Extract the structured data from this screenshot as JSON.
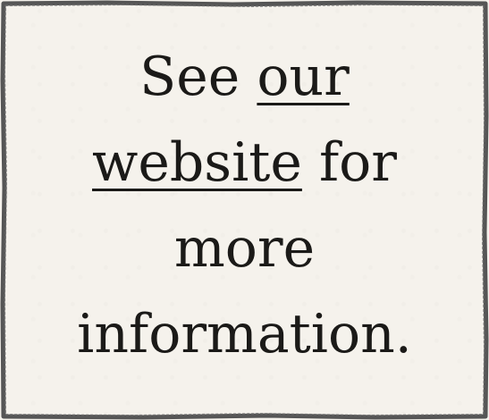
{
  "notice": {
    "prefix": "See ",
    "link_our": "our",
    "link_website": "website",
    "after_link": " for",
    "line3": "more",
    "line4": "information."
  },
  "colors": {
    "background": "#f5f2ec",
    "border": "#555555",
    "text": "#1b1a18"
  }
}
